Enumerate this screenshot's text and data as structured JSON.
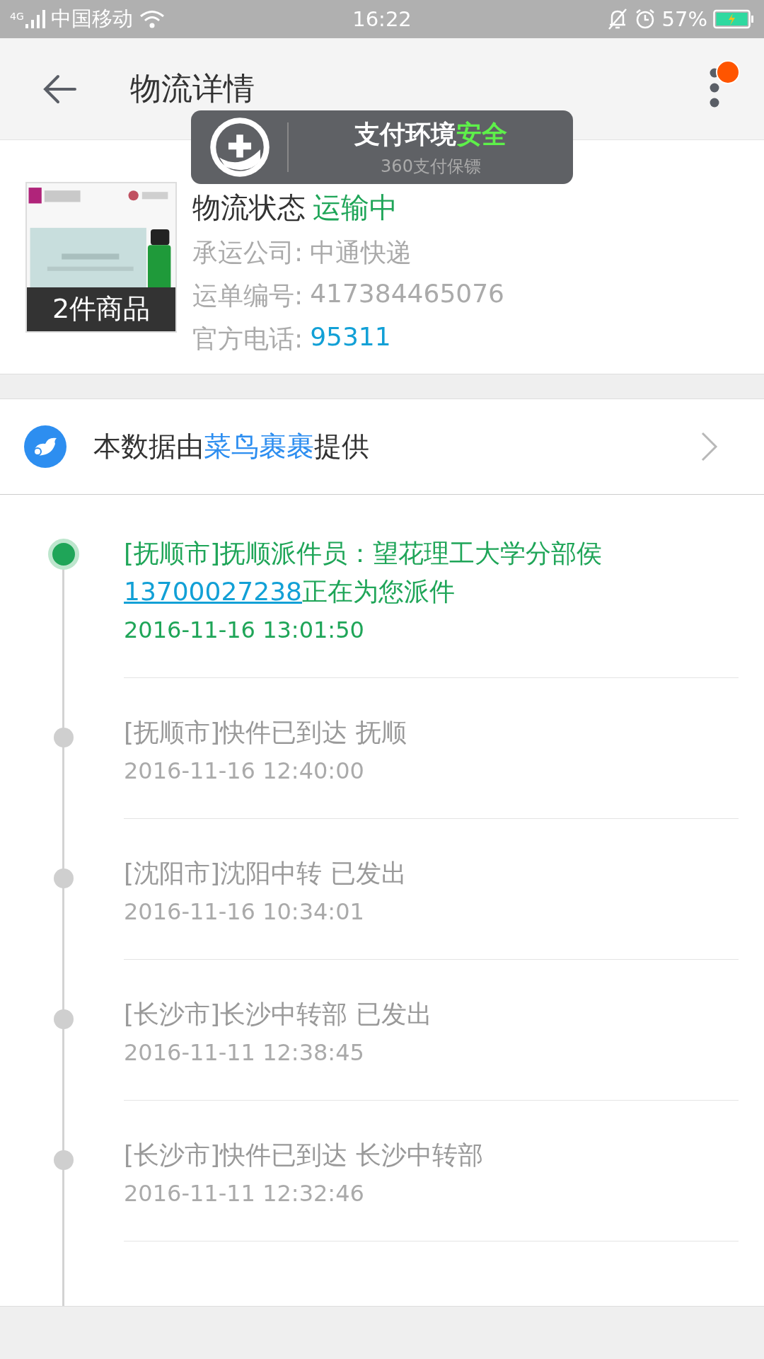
{
  "status_bar": {
    "network": "4G",
    "carrier": "中国移动",
    "time": "16:22",
    "battery": "57%"
  },
  "header": {
    "title": "物流详情",
    "notification": true
  },
  "toast": {
    "title": "支付环境**安全**",
    "subtitle": "360支付保镖"
  },
  "shipment": {
    "item_count": "2件商品",
    "status_label": "物流状态",
    "status": "运输中",
    "fields": [
      {
        "label": "承运公司:",
        "value": "中通快递",
        "kind": "text"
      },
      {
        "label": "运单编号:",
        "value": "417384465076",
        "kind": "text"
      },
      {
        "label": "官方电话:",
        "value": "95311",
        "kind": "phone"
      }
    ]
  },
  "provider": {
    "before": "本数据由",
    "name": "菜鸟裹裹",
    "after": "提供"
  },
  "events": [
    {
      "text": "[抚顺市]抚顺派件员：望花理工大学分部侯",
      "link": "13700027238",
      "text_end": "正在为您派件",
      "time": "2016-11-16 13:01:50",
      "selected": true
    },
    {
      "text": "[抚顺市]快件已到达 抚顺",
      "time": "2016-11-16 12:40:00",
      "selected": false
    },
    {
      "text": "[沈阳市]沈阳中转 已发出",
      "time": "2016-11-16 10:34:01",
      "selected": false
    },
    {
      "text": "[长沙市]长沙中转部 已发出",
      "time": "2016-11-11 12:38:45",
      "selected": false
    },
    {
      "text": "[长沙市]快件已到达 长沙中转部",
      "time": "2016-11-11 12:32:46",
      "selected": false
    }
  ]
}
